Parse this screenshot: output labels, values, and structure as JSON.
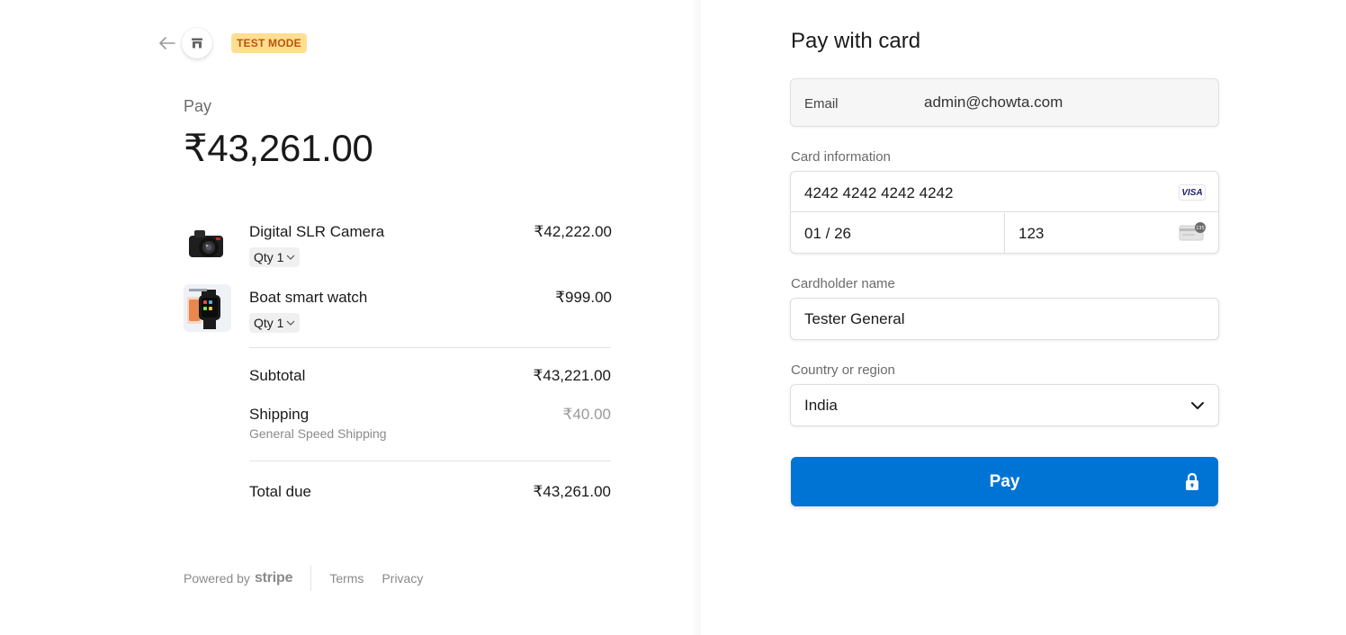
{
  "header": {
    "test_mode_badge": "TEST MODE"
  },
  "summary": {
    "pay_label": "Pay",
    "amount": "₹43,261.00",
    "items": [
      {
        "name": "Digital SLR Camera",
        "qty": "Qty 1",
        "price": "₹42,222.00",
        "image": "camera-image"
      },
      {
        "name": "Boat smart watch",
        "qty": "Qty 1",
        "price": "₹999.00",
        "image": "smartwatch-image"
      }
    ],
    "subtotal_label": "Subtotal",
    "subtotal_value": "₹43,221.00",
    "shipping_label": "Shipping",
    "shipping_method": "General Speed Shipping",
    "shipping_value": "₹40.00",
    "total_label": "Total due",
    "total_value": "₹43,261.00"
  },
  "footer": {
    "powered_by": "Powered by",
    "brand": "stripe",
    "terms": "Terms",
    "privacy": "Privacy"
  },
  "form": {
    "title": "Pay with card",
    "email_label": "Email",
    "email_value": "admin@chowta.com",
    "card_label": "Card information",
    "card_number": "4242 4242 4242 4242",
    "card_brand": "VISA",
    "card_expiry": "01 / 26",
    "card_cvc": "123",
    "cardholder_label": "Cardholder name",
    "cardholder_value": "Tester General",
    "country_label": "Country or region",
    "country_value": "India",
    "pay_button": "Pay"
  },
  "colors": {
    "accent": "#0074d4",
    "badge_bg": "#ffde92",
    "badge_text": "#bb5504"
  }
}
